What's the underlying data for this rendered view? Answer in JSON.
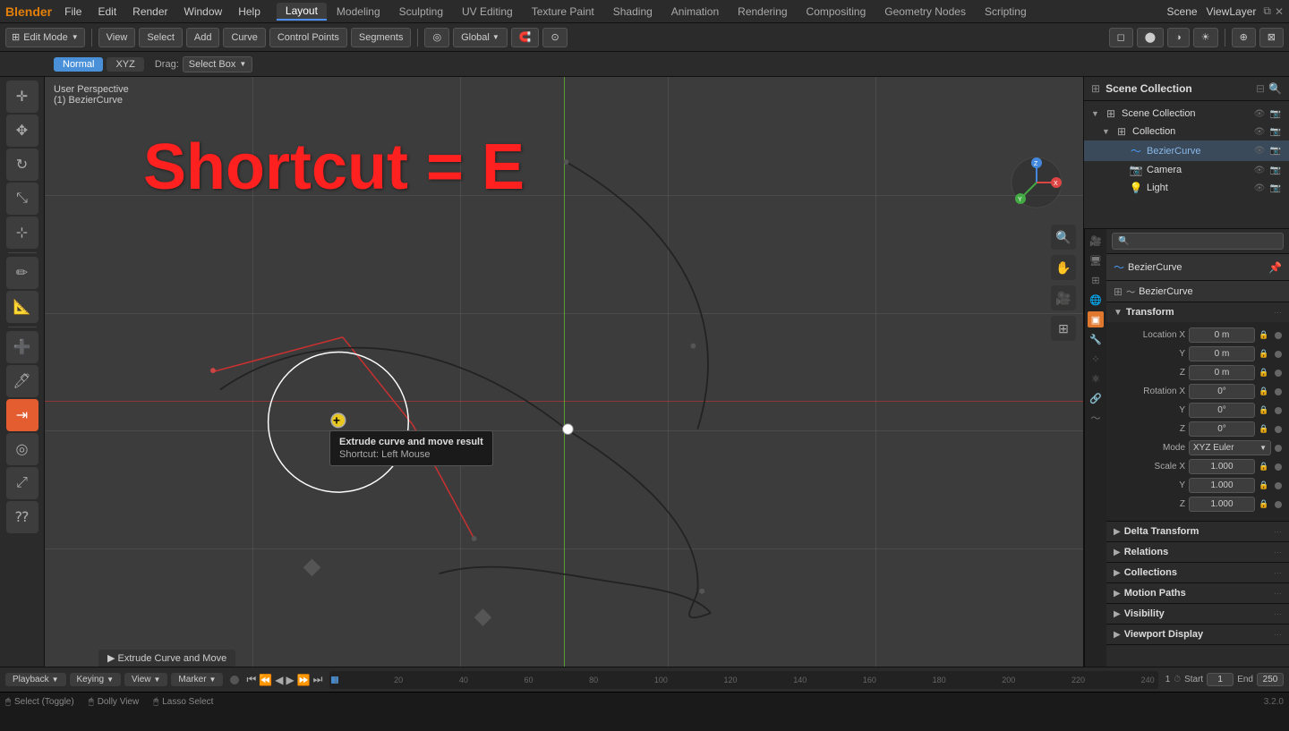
{
  "app": {
    "title": "Blender",
    "version": "3.2.0"
  },
  "topMenu": {
    "logo": "⬡",
    "items": [
      "File",
      "Edit",
      "Render",
      "Window",
      "Help"
    ]
  },
  "workspaceTabs": {
    "tabs": [
      "Layout",
      "Modeling",
      "Sculpting",
      "UV Editing",
      "Texture Paint",
      "Shading",
      "Animation",
      "Rendering",
      "Compositing",
      "Geometry Nodes",
      "Scripting"
    ],
    "active": "Layout"
  },
  "sceneLabel": "Scene",
  "viewLayerLabel": "ViewLayer",
  "toolbarLeft": {
    "modeDropdown": "Edit Mode",
    "viewLabel": "View",
    "selectLabel": "Select",
    "addLabel": "Add",
    "curveLabel": "Curve",
    "controlPointsLabel": "Control Points",
    "segmentsLabel": "Segments"
  },
  "toolbarRight": {
    "globalDropdown": "Global",
    "pivotIcon": "◎"
  },
  "normalRow": {
    "normalBtn": "Normal",
    "xyzBtn": "XYZ",
    "dragLabel": "Drag:",
    "selectBoxDropdown": "Select Box"
  },
  "viewport": {
    "perspective": "User Perspective",
    "objectName": "(1) BezierCurve",
    "shortcutText": "Shortcut = E",
    "tooltip": {
      "title": "Extrude curve and move result",
      "shortcut": "Shortcut: Left Mouse"
    },
    "extrudeStatus": "Extrude Curve and Move"
  },
  "gizmo": {
    "xLabel": "X",
    "yLabel": "Y",
    "zLabel": "Z",
    "xColor": "#e04040",
    "yColor": "#40cc40",
    "zColor": "#4080e0"
  },
  "rightPanel": {
    "searchPlaceholder": "",
    "sceneCollection": "Scene Collection",
    "collection": "Collection",
    "bezierCurve": "BezierCurve",
    "camera": "Camera",
    "light": "Light"
  },
  "propsPanel": {
    "objectName": "BezierCurve",
    "dataName": "BezierCurve",
    "transform": {
      "title": "Transform",
      "locationX": "0 m",
      "locationY": "0 m",
      "locationZ": "0 m",
      "rotationX": "0°",
      "rotationY": "0°",
      "rotationZ": "0°",
      "modeLabel": "Mode",
      "modeValue": "XYZ Euler",
      "scaleX": "1.000",
      "scaleY": "1.000",
      "scaleZ": "1.000"
    },
    "deltaTransform": "Delta Transform",
    "relations": "Relations",
    "collections": "Collections",
    "motionPaths": "Motion Paths",
    "visibility": "Visibility",
    "viewportDisplay": "Viewport Display"
  },
  "bottomBar": {
    "playbackLabel": "Playback",
    "keyingLabel": "Keying",
    "viewLabel": "View",
    "markerLabel": "Marker",
    "frameStart": "Start",
    "startValue": "1",
    "frameEnd": "End",
    "endValue": "250",
    "currentFrame": "1",
    "timelineMarks": [
      "1",
      "20",
      "40",
      "60",
      "80",
      "100",
      "120",
      "140",
      "160",
      "180",
      "200",
      "220",
      "240"
    ]
  },
  "statusBar": {
    "selectToggle": "Select (Toggle)",
    "dollyView": "Dolly View",
    "lassoSelect": "Lasso Select",
    "version": "3.2.0"
  }
}
